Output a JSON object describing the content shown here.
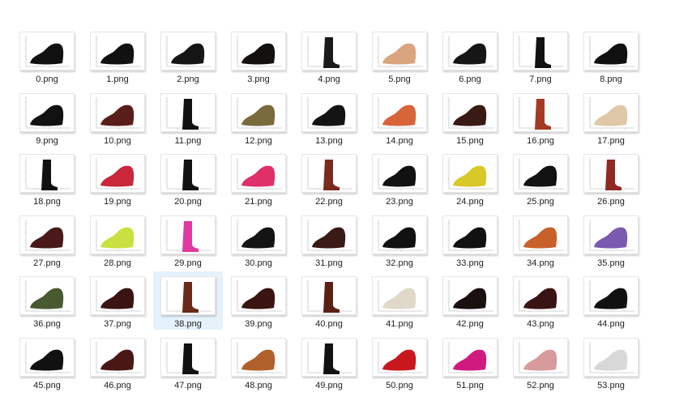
{
  "window": {
    "view": "large-icons",
    "selected_file": "38.png"
  },
  "files": [
    {
      "name": "0.png",
      "icon": "black-shoe-thumbnail",
      "color": "#111111"
    },
    {
      "name": "1.png",
      "icon": "black-shoe-thumbnail",
      "color": "#111111"
    },
    {
      "name": "2.png",
      "icon": "black-shoe-thumbnail",
      "color": "#151515"
    },
    {
      "name": "3.png",
      "icon": "black-shoe-thumbnail",
      "color": "#141010"
    },
    {
      "name": "4.png",
      "icon": "black-boot-thumbnail",
      "color": "#1c1a18"
    },
    {
      "name": "5.png",
      "icon": "tan-heeled-sandal-thumbnail",
      "color": "#d8a57e"
    },
    {
      "name": "6.png",
      "icon": "black-loafer-thumbnail",
      "color": "#161616"
    },
    {
      "name": "7.png",
      "icon": "black-tall-boot-thumbnail",
      "color": "#111111"
    },
    {
      "name": "8.png",
      "icon": "black-pump-thumbnail",
      "color": "#111111"
    },
    {
      "name": "9.png",
      "icon": "black-shoe-thumbnail",
      "color": "#121212"
    },
    {
      "name": "10.png",
      "icon": "dark-red-shoe-thumbnail",
      "color": "#5a1e1a"
    },
    {
      "name": "11.png",
      "icon": "black-tall-boot-thumbnail",
      "color": "#111111"
    },
    {
      "name": "12.png",
      "icon": "olive-clog-thumbnail",
      "color": "#7a6b3c"
    },
    {
      "name": "13.png",
      "icon": "black-heel-thumbnail",
      "color": "#141414"
    },
    {
      "name": "14.png",
      "icon": "orange-sandal-thumbnail",
      "color": "#d8643a"
    },
    {
      "name": "15.png",
      "icon": "dark-brown-shoe-thumbnail",
      "color": "#3a1a14"
    },
    {
      "name": "16.png",
      "icon": "red-tall-boot-thumbnail",
      "color": "#a43a24"
    },
    {
      "name": "17.png",
      "icon": "beige-flat-thumbnail",
      "color": "#dfc8a8"
    },
    {
      "name": "18.png",
      "icon": "black-ankle-shoe-thumbnail",
      "color": "#111111"
    },
    {
      "name": "19.png",
      "icon": "red-sneaker-thumbnail",
      "color": "#c8283a"
    },
    {
      "name": "20.png",
      "icon": "black-tall-boot-thumbnail",
      "color": "#111111"
    },
    {
      "name": "21.png",
      "icon": "black-pink-sneaker-thumbnail",
      "color": "#e0306a"
    },
    {
      "name": "22.png",
      "icon": "brown-boot-thumbnail",
      "color": "#7a2a1e"
    },
    {
      "name": "23.png",
      "icon": "black-heel-thumbnail",
      "color": "#111111"
    },
    {
      "name": "24.png",
      "icon": "yellow-clog-thumbnail",
      "color": "#d8c828"
    },
    {
      "name": "25.png",
      "icon": "black-flip-flop-thumbnail",
      "color": "#121212"
    },
    {
      "name": "26.png",
      "icon": "red-tall-boot-thumbnail",
      "color": "#8e2a22"
    },
    {
      "name": "27.png",
      "icon": "dark-red-shoe-thumbnail",
      "color": "#4a1a1a"
    },
    {
      "name": "28.png",
      "icon": "lime-sneaker-thumbnail",
      "color": "#c8e040"
    },
    {
      "name": "29.png",
      "icon": "pink-boot-thumbnail",
      "color": "#e03aa0"
    },
    {
      "name": "30.png",
      "icon": "black-shoe-thumbnail",
      "color": "#141414"
    },
    {
      "name": "31.png",
      "icon": "brown-shoe-thumbnail",
      "color": "#3a1a14"
    },
    {
      "name": "32.png",
      "icon": "black-shoe-thumbnail",
      "color": "#111111"
    },
    {
      "name": "33.png",
      "icon": "black-shoe-thumbnail",
      "color": "#111111"
    },
    {
      "name": "34.png",
      "icon": "orange-wedge-thumbnail",
      "color": "#c8602a"
    },
    {
      "name": "35.png",
      "icon": "black-purple-sneaker-thumbnail",
      "color": "#7a5ab0"
    },
    {
      "name": "36.png",
      "icon": "camo-sneaker-thumbnail",
      "color": "#4a5a30"
    },
    {
      "name": "37.png",
      "icon": "dark-red-shoe-thumbnail",
      "color": "#3a1412"
    },
    {
      "name": "38.png",
      "icon": "brown-boot-thumbnail",
      "color": "#6a2a1a"
    },
    {
      "name": "39.png",
      "icon": "dark-red-shoe-thumbnail",
      "color": "#3a1410"
    },
    {
      "name": "40.png",
      "icon": "brown-ankle-boot-thumbnail",
      "color": "#5a2014"
    },
    {
      "name": "41.png",
      "icon": "cream-slip-on-thumbnail",
      "color": "#e0d8c8"
    },
    {
      "name": "42.png",
      "icon": "black-red-shoe-thumbnail",
      "color": "#1a1010"
    },
    {
      "name": "43.png",
      "icon": "dark-red-sneaker-thumbnail",
      "color": "#3a1414"
    },
    {
      "name": "44.png",
      "icon": "black-shoe-thumbnail",
      "color": "#111111"
    },
    {
      "name": "45.png",
      "icon": "black-flat-thumbnail",
      "color": "#111111"
    },
    {
      "name": "46.png",
      "icon": "dark-red-shoe-thumbnail",
      "color": "#4a1814"
    },
    {
      "name": "47.png",
      "icon": "black-ankle-boot-thumbnail",
      "color": "#111111"
    },
    {
      "name": "48.png",
      "icon": "tan-heel-thumbnail",
      "color": "#b0602a"
    },
    {
      "name": "49.png",
      "icon": "black-boot-thumbnail",
      "color": "#111111"
    },
    {
      "name": "50.png",
      "icon": "red-ballet-flat-thumbnail",
      "color": "#c8181e"
    },
    {
      "name": "51.png",
      "icon": "pink-mary-jane-thumbnail",
      "color": "#d01a80"
    },
    {
      "name": "52.png",
      "icon": "pink-shoe-thumbnail",
      "color": "#d89a9a"
    },
    {
      "name": "53.png",
      "icon": "white-black-sneaker-thumbnail",
      "color": "#d8d8d8"
    }
  ]
}
